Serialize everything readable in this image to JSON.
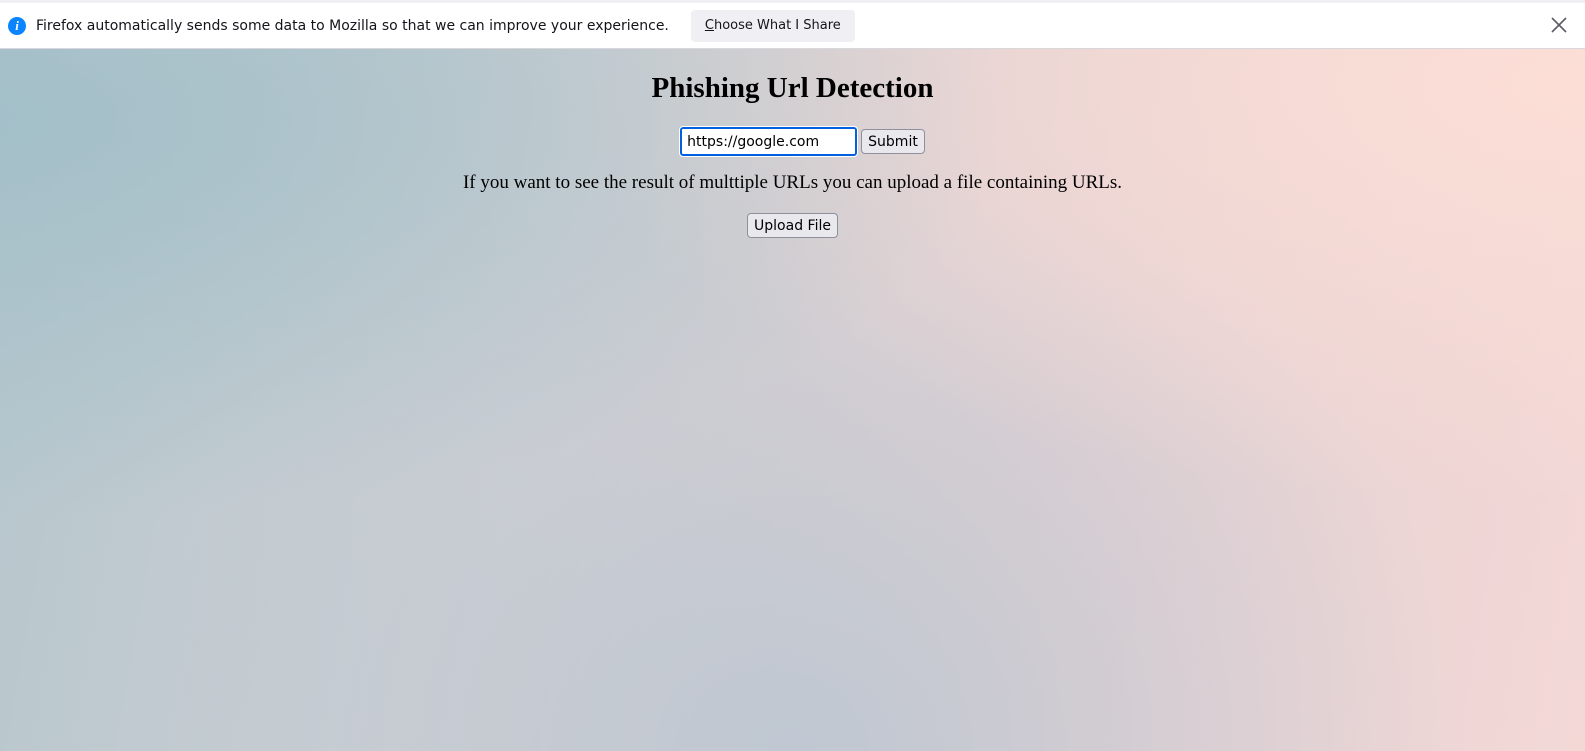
{
  "notification": {
    "icon": "info-icon",
    "message": "Firefox automatically sends some data to Mozilla so that we can improve your experience.",
    "button_accel": "C",
    "button_rest": "hoose What I Share",
    "close_icon": "close-icon"
  },
  "page": {
    "title": "Phishing Url Detection",
    "url_input_value": "https://google.com",
    "submit_label": "Submit",
    "info_text": "If you want to see the result of multtiple URLs you can upload a file containing URLs.",
    "upload_label": "Upload File"
  },
  "colors": {
    "accent": "#0060df",
    "info_icon": "#0a84ff"
  }
}
